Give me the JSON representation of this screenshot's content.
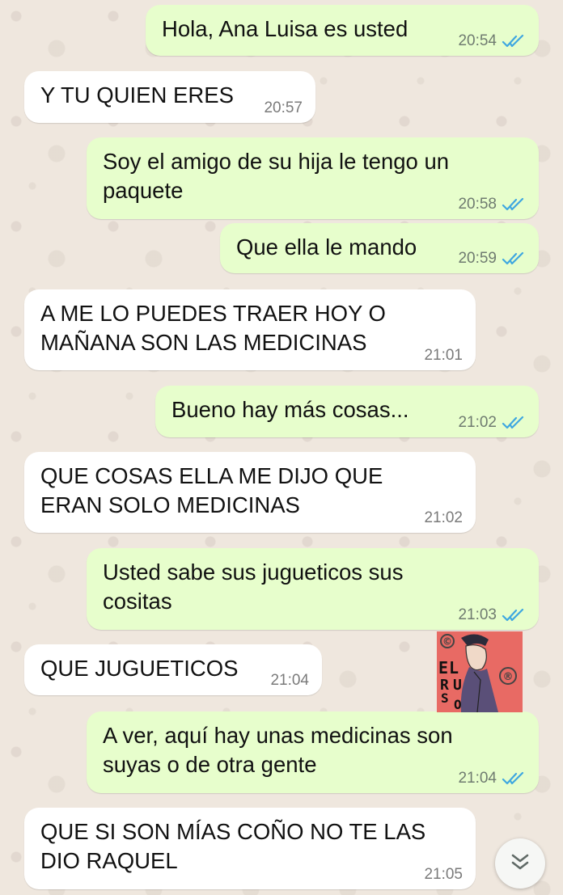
{
  "messages": [
    {
      "dir": "out",
      "text": "Hola, Ana Luisa es usted",
      "time": "20:54",
      "read": true
    },
    {
      "dir": "in",
      "text": "Y TU QUIEN ERES",
      "time": "20:57"
    },
    {
      "dir": "out",
      "text": "Soy el amigo de su hija le tengo un\npaquete",
      "time": "20:58",
      "read": true
    },
    {
      "dir": "out",
      "text": "Que ella le mando",
      "time": "20:59",
      "read": true
    },
    {
      "dir": "in",
      "text": "A ME LO PUEDES TRAER HOY O\nMAÑANA SON LAS MEDICINAS",
      "time": "21:01"
    },
    {
      "dir": "out",
      "text": "Bueno hay más cosas...",
      "time": "21:02",
      "read": true
    },
    {
      "dir": "in",
      "text": "QUE COSAS ELLA ME DIJO QUE\nERAN SOLO MEDICINAS",
      "time": "21:02"
    },
    {
      "dir": "out",
      "text": "Usted sabe sus jugueticos sus\ncositas",
      "time": "21:03",
      "read": true
    },
    {
      "dir": "in",
      "text": "QUE JUGUETICOS",
      "time": "21:04"
    },
    {
      "dir": "out",
      "text": "A ver, aquí hay unas medicinas son\nsuyas o de otra gente",
      "time": "21:04",
      "read": true
    },
    {
      "dir": "in",
      "text": "QUE SI SON MÍAS COÑO NO TE LAS\nDIO RAQUEL",
      "time": "21:05"
    }
  ],
  "watermark": {
    "copyright": "©",
    "registered": "®",
    "letters": [
      "E",
      "L",
      "R",
      "U",
      "S",
      "O"
    ]
  },
  "colors": {
    "outgoing": "#e7fecc",
    "incoming": "#ffffff",
    "read_ticks": "#3fa7e0",
    "wallpaper": "#efe7de"
  },
  "icons": {
    "read_status": "double-check-icon",
    "scroll": "chevron-double-down-icon"
  }
}
